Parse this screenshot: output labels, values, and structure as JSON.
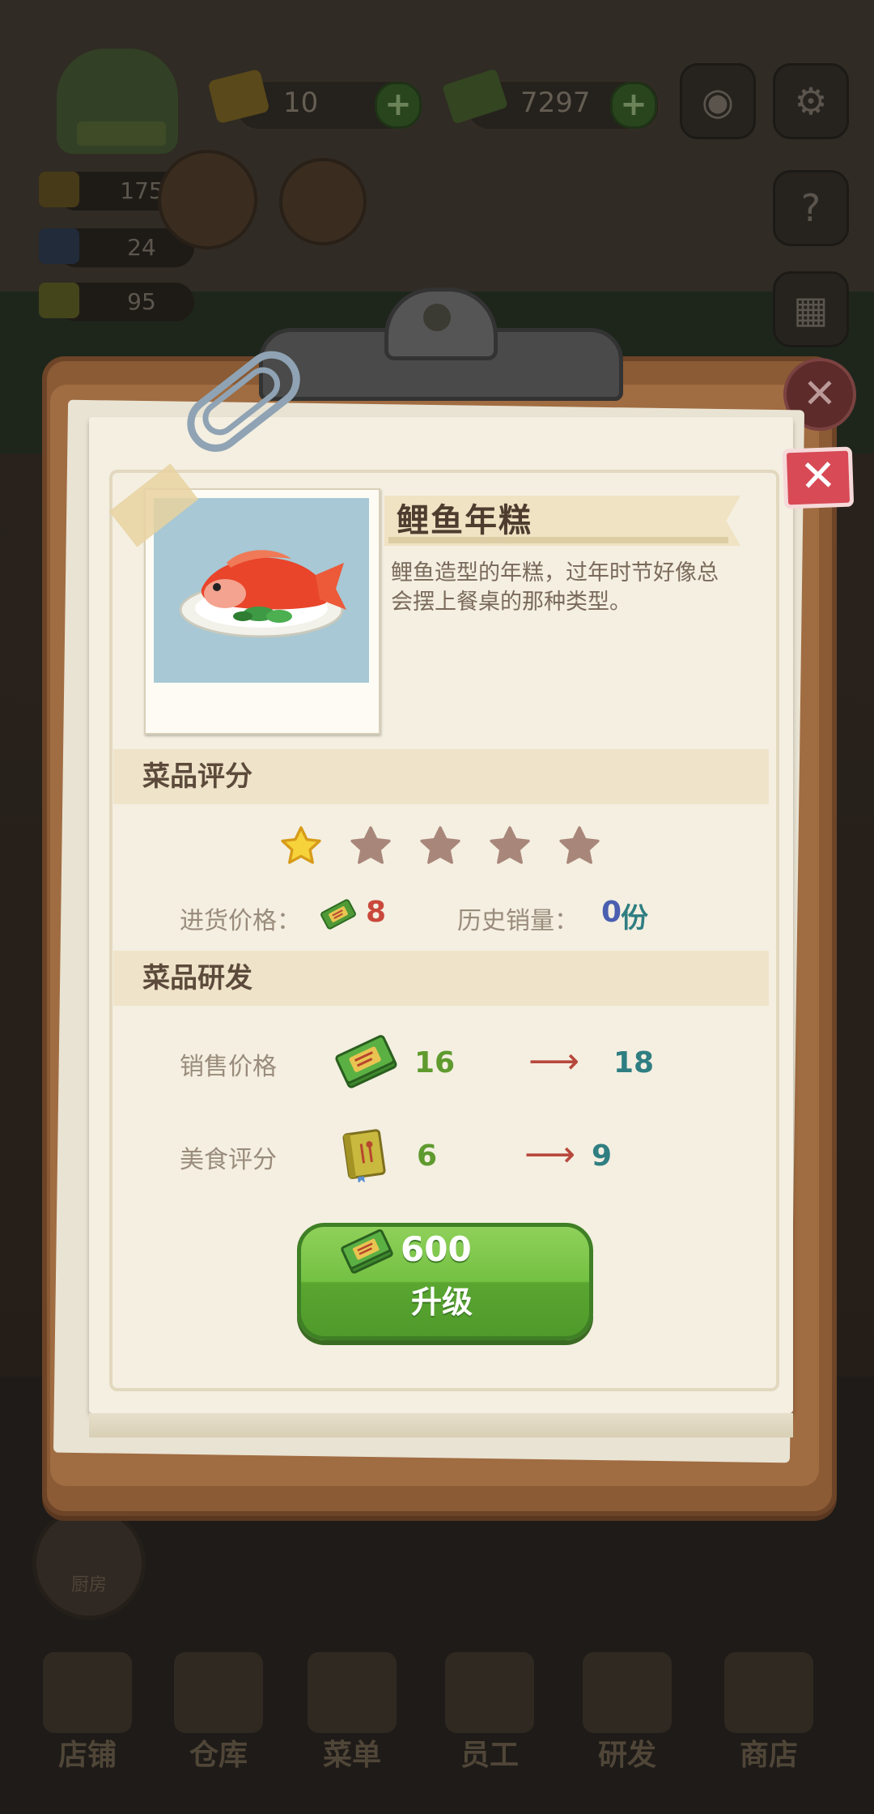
{
  "hud": {
    "coins_value": "10",
    "cash_value": "7297",
    "plus_label": "+",
    "stats": [
      {
        "value": "175"
      },
      {
        "value": "24"
      },
      {
        "value": "95"
      }
    ]
  },
  "dish": {
    "name": "鲤鱼年糕",
    "description": "鲤鱼造型的年糕，过年时节好像总会摆上餐桌的那种类型。"
  },
  "rating_section": {
    "title": "菜品评分",
    "stars_filled": 1,
    "stars_total": 5,
    "purchase_price_label": "进货价格：",
    "purchase_price_value": "8",
    "sales_label": "历史销量：",
    "sales_value": "0",
    "sales_unit": "份"
  },
  "research_section": {
    "title": "菜品研发",
    "rows": [
      {
        "label": "销售价格",
        "from": "16",
        "to": "18",
        "arrow": "⟶"
      },
      {
        "label": "美食评分",
        "from": "6",
        "to": "9",
        "arrow": "⟶"
      }
    ]
  },
  "upgrade": {
    "cost": "600",
    "label": "升级"
  },
  "close_label": "✕",
  "side_button": {
    "label": "厨房"
  },
  "bottom_nav": [
    {
      "label": "店铺"
    },
    {
      "label": "仓库"
    },
    {
      "label": "菜单"
    },
    {
      "label": "员工"
    },
    {
      "label": "研发"
    },
    {
      "label": "商店"
    }
  ],
  "colors": {
    "paper": "#f4efe1",
    "section_bar": "#efe4c9",
    "button_green": "#74c143",
    "close_red": "#d74a56",
    "star_filled": "#f6d33a",
    "star_empty": "#a8877a"
  }
}
